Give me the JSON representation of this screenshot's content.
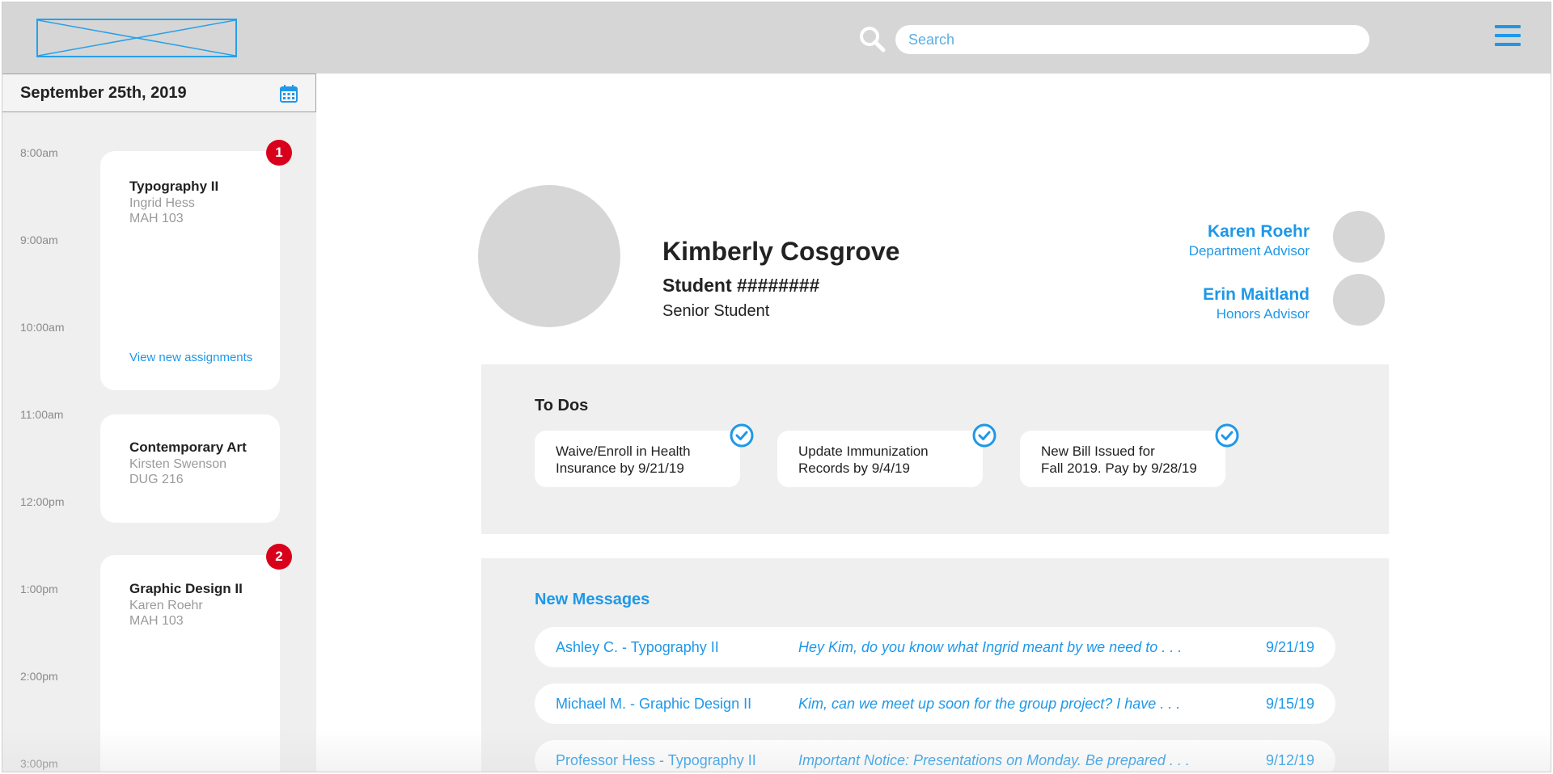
{
  "header": {
    "logo_alt": "logo placeholder",
    "search_placeholder": "Search"
  },
  "sidebar": {
    "date": "September 25th, 2019",
    "times": [
      "8:00am",
      "9:00am",
      "10:00am",
      "11:00am",
      "12:00pm",
      "1:00pm",
      "2:00pm",
      "3:00pm"
    ],
    "classes": [
      {
        "title": "Typography II",
        "instructor": "Ingrid Hess",
        "room": "MAH 103",
        "link": "View new assignments",
        "badge": "1"
      },
      {
        "title": "Contemporary Art",
        "instructor": "Kirsten Swenson",
        "room": "DUG 216"
      },
      {
        "title": "Graphic Design II",
        "instructor": "Karen Roehr",
        "room": "MAH 103",
        "badge": "2"
      }
    ]
  },
  "profile": {
    "name": "Kimberly Cosgrove",
    "student_id": "Student ########",
    "level": "Senior Student",
    "advisors": [
      {
        "name": "Karen Roehr",
        "role": "Department Advisor"
      },
      {
        "name": "Erin Maitland",
        "role": "Honors Advisor"
      }
    ]
  },
  "todos": {
    "title": "To Dos",
    "items": [
      {
        "line1": "Waive/Enroll in Health",
        "line2": "Insurance by 9/21/19"
      },
      {
        "line1": "Update Immunization",
        "line2": "Records by 9/4/19"
      },
      {
        "line1": "New Bill Issued for",
        "line2": "Fall 2019. Pay by 9/28/19"
      }
    ]
  },
  "messages": {
    "title": "New Messages",
    "items": [
      {
        "sender": "Ashley C. - Typography II",
        "preview": "Hey Kim, do you know what Ingrid meant by we need to . . .",
        "date": "9/21/19"
      },
      {
        "sender": "Michael M. - Graphic Design II",
        "preview": "Kim, can we meet up soon for the group project? I have . . .",
        "date": "9/15/19"
      },
      {
        "sender": "Professor Hess - Typography II",
        "preview": "Important Notice: Presentations on Monday. Be prepared . . .",
        "date": "9/12/19"
      }
    ]
  },
  "colors": {
    "accent": "#1e98e8",
    "badge": "#d9001b",
    "header_bg": "#d6d6d6",
    "panel_bg": "#efefef"
  },
  "icons": [
    "logo-placeholder-icon",
    "search-icon",
    "menu-icon",
    "calendar-icon",
    "check-circle-icon"
  ]
}
